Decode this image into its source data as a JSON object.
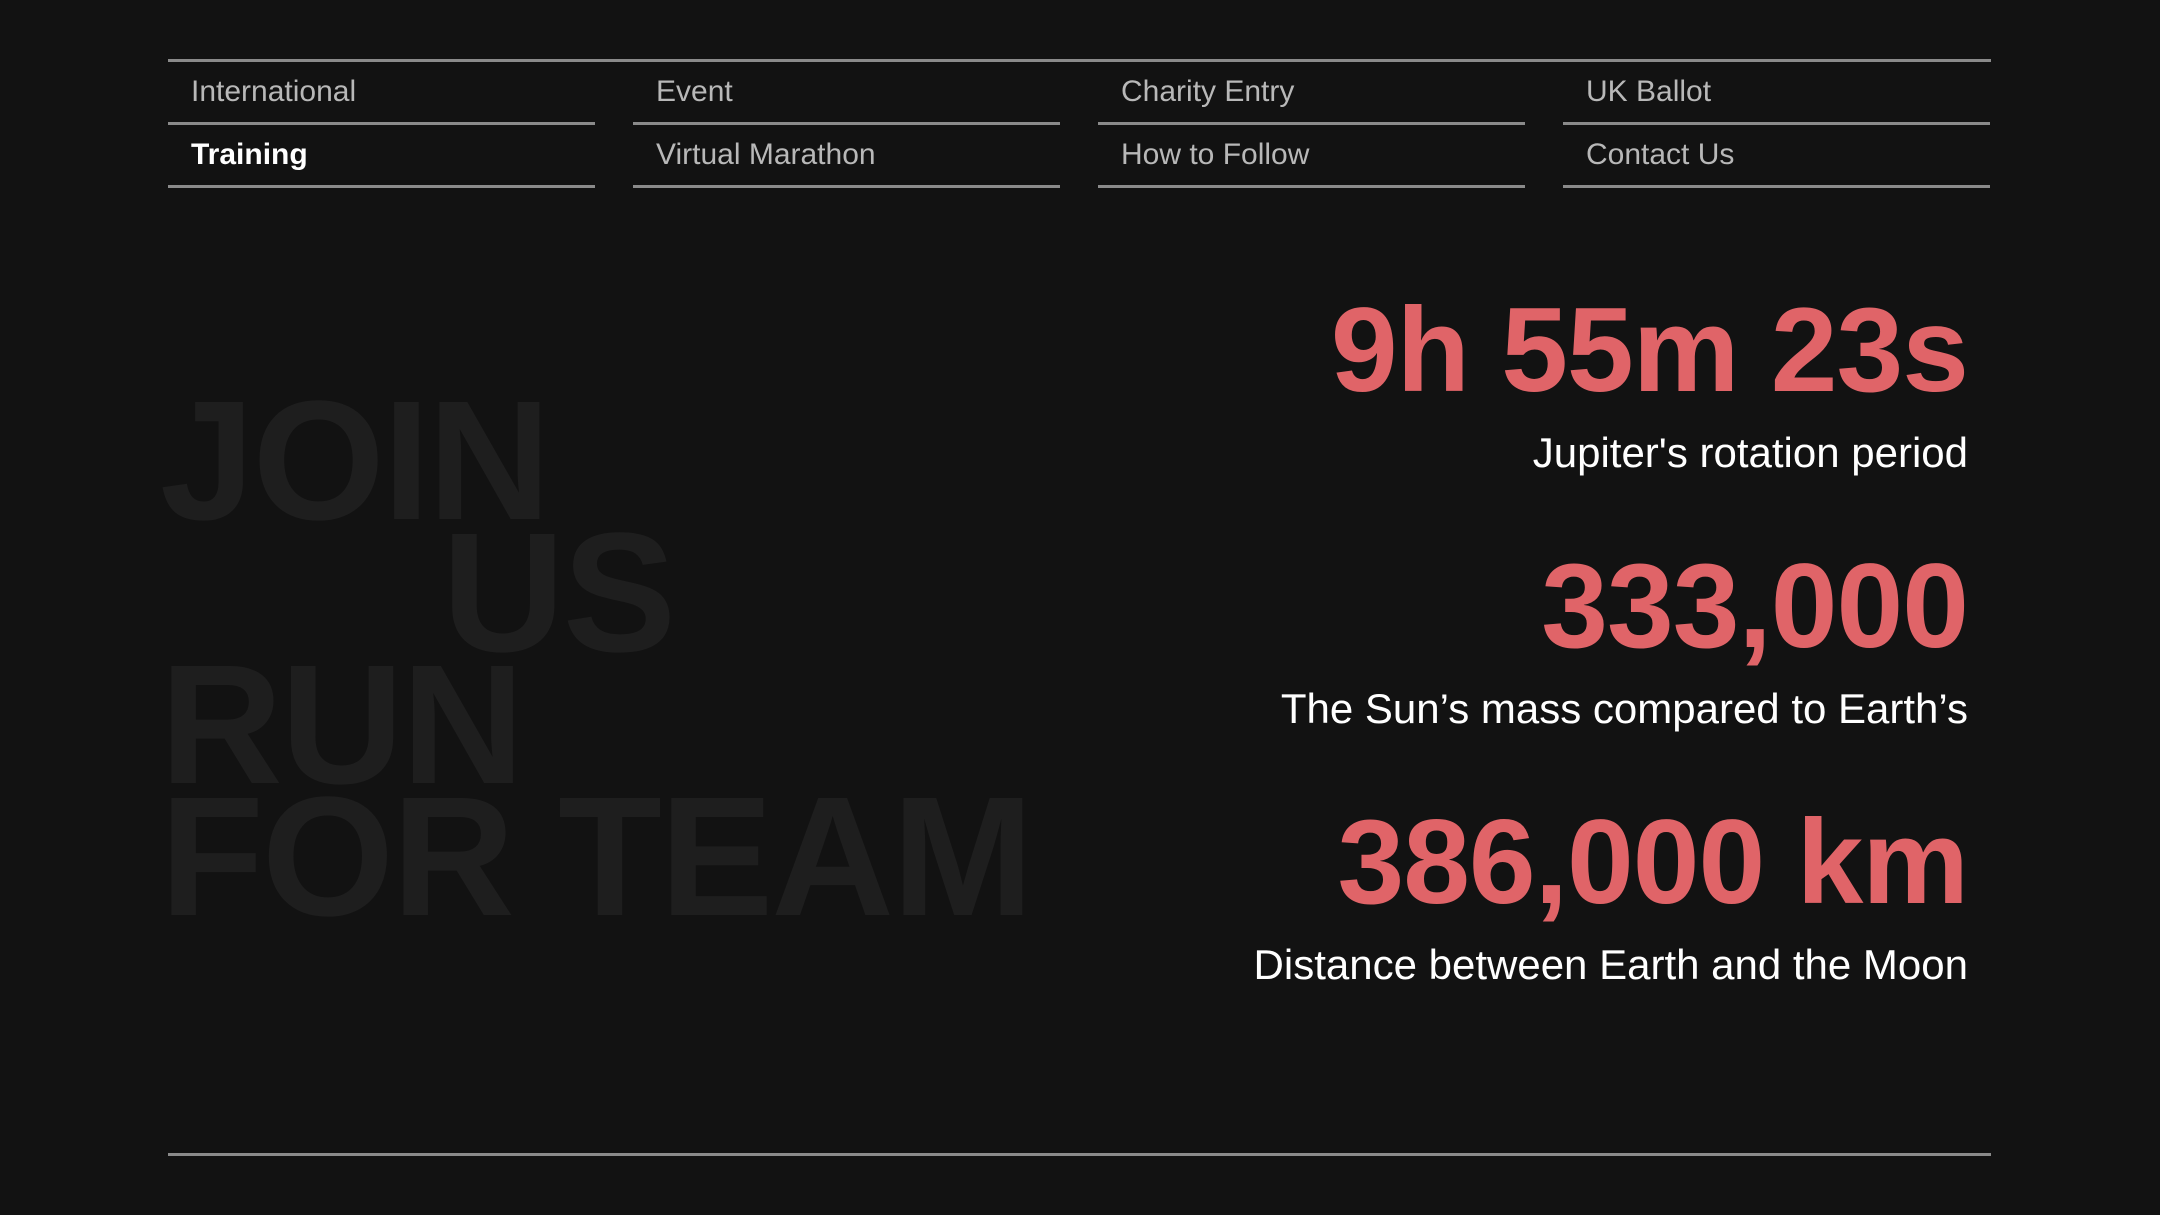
{
  "nav": {
    "items": [
      {
        "label": "International"
      },
      {
        "label": "Event"
      },
      {
        "label": "Charity Entry"
      },
      {
        "label": "UK Ballot"
      },
      {
        "label": "Training"
      },
      {
        "label": "Virtual Marathon"
      },
      {
        "label": "How to Follow"
      },
      {
        "label": "Contact Us"
      }
    ],
    "active": "Training"
  },
  "background_text": {
    "line1": "JOIN",
    "line2": "US",
    "line3": "RUN",
    "line4": "FOR TEAM"
  },
  "stats": [
    {
      "value": "9h 55m 23s",
      "label": "Jupiter's rotation period"
    },
    {
      "value": "333,000",
      "label": "The Sun’s mass compared to Earth’s"
    },
    {
      "value": "386,000 km",
      "label": "Distance between Earth and the Moon"
    }
  ],
  "colors": {
    "background": "#121212",
    "accent": "#e06468",
    "rule": "#8a8a8a"
  }
}
